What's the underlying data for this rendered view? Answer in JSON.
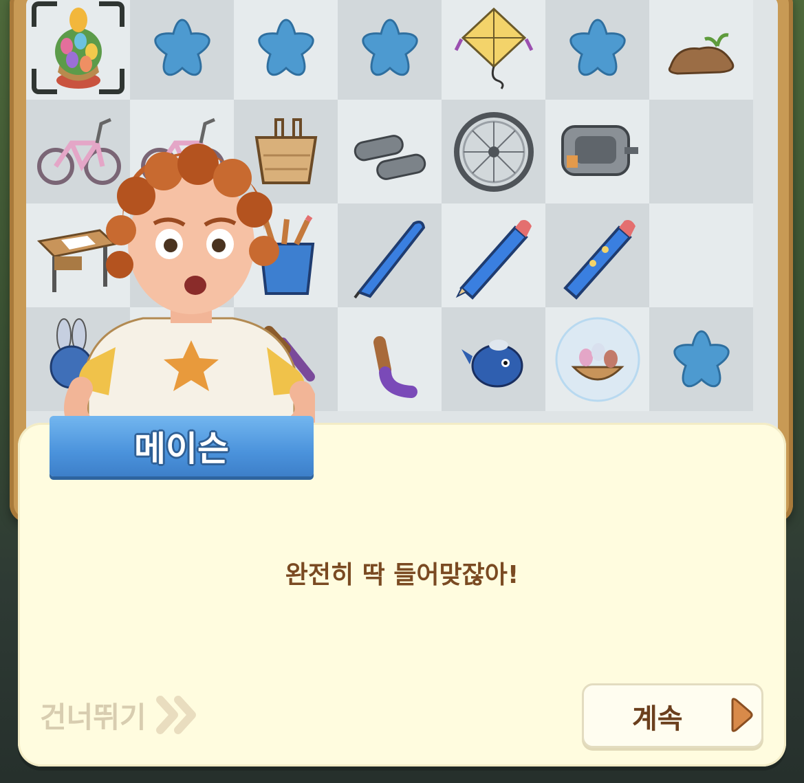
{
  "speaker": {
    "name": "메이슨"
  },
  "dialog": {
    "text": "완전히 딱 들어맞잖아!"
  },
  "buttons": {
    "skip_label": "건너뛰기",
    "continue_label": "계속"
  },
  "colors": {
    "dialog_bg": "#fffcdf",
    "name_banner": "#4b93dc",
    "dialog_text": "#7a4a22",
    "skip_text": "#d8cdb0",
    "continue_text": "#6b3f1d",
    "continue_arrow": "#d88a4a"
  },
  "board": {
    "items": [
      "easter-egg-tree-icon",
      "blue-star-icon",
      "blue-star-icon",
      "blue-star-icon",
      "kite-icon",
      "blue-star-icon",
      "dirt-mound-icon",
      "pink-bicycle-icon",
      "pink-bicycle-icon",
      "bike-basket-icon",
      "handlebar-grips-icon",
      "bike-wheel-icon",
      "bike-pedal-icon",
      "empty-cell",
      "school-desk-icon",
      "pencil-case-icon",
      "pencil-cup-icon",
      "blue-pen-icon",
      "blue-pencil-icon",
      "chewed-pencil-icon",
      "empty-cell",
      "bunny-toy-icon",
      "empty-cell",
      "toy-part-icon",
      "toy-leg-icon",
      "blue-bird-icon",
      "egg-basket-bubble-icon",
      "blue-star-icon"
    ],
    "selected_index": 0
  }
}
